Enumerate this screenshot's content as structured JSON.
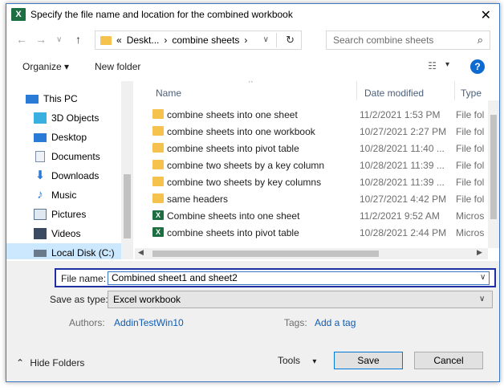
{
  "window": {
    "title": "Specify the file name and location for the combined workbook",
    "app_icon": "X",
    "close": "✕"
  },
  "address_bar": {
    "back": "←",
    "forward": "→",
    "recent": "∨",
    "up": "↑",
    "segments": [
      "«",
      "Deskt...",
      "›",
      "combine sheets",
      "›"
    ],
    "dropdown": "∨",
    "refresh": "↻",
    "search_placeholder": "Search combine sheets",
    "search_icon": "⌕"
  },
  "toolbar": {
    "organize": "Organize ▾",
    "new_folder": "New folder",
    "view_icon": "☷",
    "view_chev": "▾",
    "help": "?"
  },
  "nav": {
    "items": [
      {
        "label": "This PC",
        "icon": "computer-icon",
        "color": "#2a7bd6"
      },
      {
        "label": "3D Objects",
        "icon": "cube-icon",
        "color": "#3ab0e0"
      },
      {
        "label": "Desktop",
        "icon": "desktop-icon",
        "color": "#2a7bd6"
      },
      {
        "label": "Documents",
        "icon": "document-icon",
        "color": "#7a8ea8"
      },
      {
        "label": "Downloads",
        "icon": "download-icon",
        "color": "#2a7bd6"
      },
      {
        "label": "Music",
        "icon": "music-icon",
        "color": "#2a7bd6"
      },
      {
        "label": "Pictures",
        "icon": "picture-icon",
        "color": "#5a7590"
      },
      {
        "label": "Videos",
        "icon": "video-icon",
        "color": "#3a4a60"
      },
      {
        "label": "Local Disk (C:)",
        "icon": "disk-icon",
        "color": "#6a7a8a"
      }
    ]
  },
  "list": {
    "columns": {
      "name": "Name",
      "date": "Date modified",
      "type": "Type"
    },
    "rows": [
      {
        "name": "combine sheets into one sheet",
        "date": "11/2/2021 1:53 PM",
        "type": "File fol",
        "kind": "folder"
      },
      {
        "name": "combine sheets into one workbook",
        "date": "10/27/2021 2:27 PM",
        "type": "File fol",
        "kind": "folder"
      },
      {
        "name": "combine sheets into pivot table",
        "date": "10/28/2021 11:40 ...",
        "type": "File fol",
        "kind": "folder"
      },
      {
        "name": "combine two sheets by a key column",
        "date": "10/28/2021 11:39 ...",
        "type": "File fol",
        "kind": "folder"
      },
      {
        "name": "combine two sheets by key columns",
        "date": "10/28/2021 11:39 ...",
        "type": "File fol",
        "kind": "folder"
      },
      {
        "name": "same headers",
        "date": "10/27/2021 4:42 PM",
        "type": "File fol",
        "kind": "folder"
      },
      {
        "name": "Combine sheets into one sheet",
        "date": "11/2/2021 9:52 AM",
        "type": "Micros",
        "kind": "excel"
      },
      {
        "name": "combine sheets into pivot table",
        "date": "10/28/2021 2:44 PM",
        "type": "Micros",
        "kind": "excel"
      }
    ]
  },
  "form": {
    "file_name_label": "File name:",
    "file_name_value": "Combined sheet1 and sheet2",
    "save_as_label": "Save as type:",
    "save_as_value": "Excel workbook",
    "authors_label": "Authors:",
    "authors_value": "AddinTestWin10",
    "tags_label": "Tags:",
    "tags_value": "Add a tag",
    "hide_folders": "Hide Folders",
    "hide_icon": "⌃",
    "tools": "Tools",
    "tools_chev": "▾",
    "save": "Save",
    "cancel": "Cancel",
    "dd_chev": "∨"
  },
  "colors": {
    "accent": "#0078d7",
    "link": "#0d5cb6",
    "selection": "#cce8ff",
    "focus_box": "#1d2fa3"
  }
}
